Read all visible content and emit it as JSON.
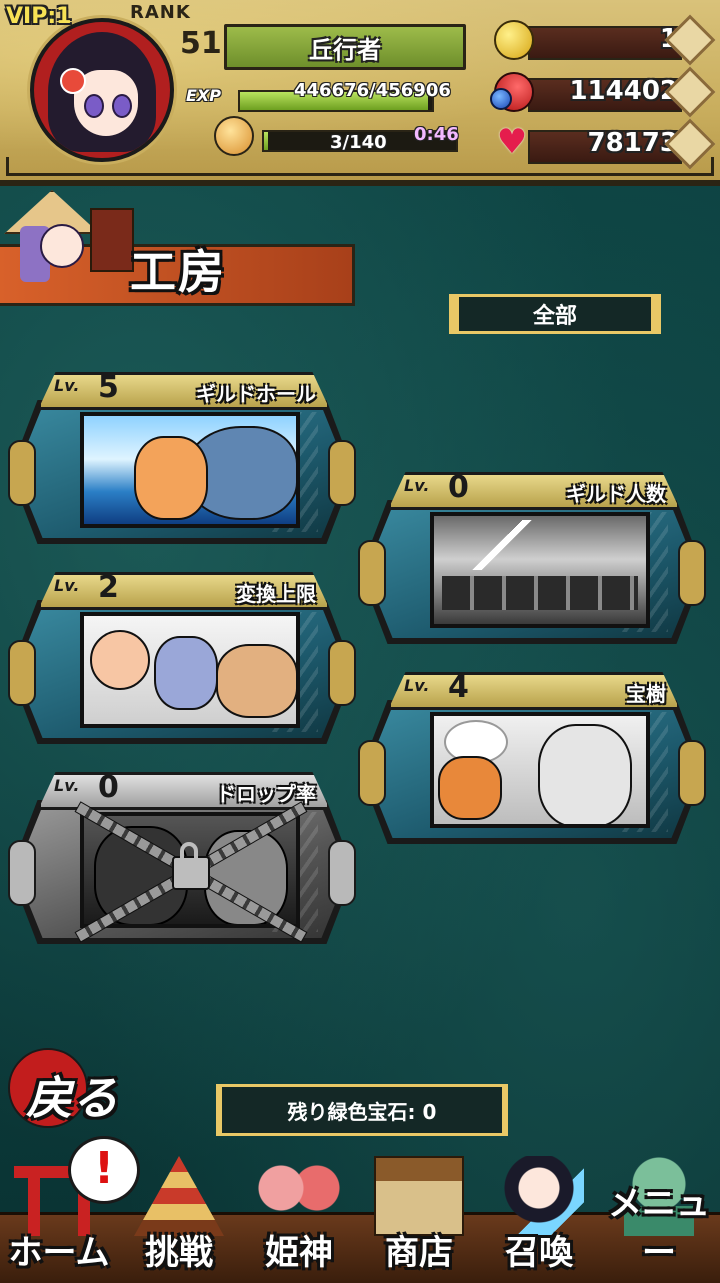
{
  "status": {
    "vip": "VIP:1",
    "rank_label": "RANK",
    "rank_value": "51",
    "title": "丘行者",
    "exp_label": "EXP",
    "exp_text": "446676/456906",
    "exp_progress": 0.977,
    "stamina_text": "3/140",
    "stamina_progress": 0.021,
    "timer": "0:46"
  },
  "resources": [
    {
      "icon": "gold-coin-icon",
      "value": "1"
    },
    {
      "icon": "orb-icon",
      "value": "114402"
    },
    {
      "icon": "winged-heart-icon",
      "value": "78173"
    }
  ],
  "header": {
    "title": "工房"
  },
  "filter": {
    "label": "全部"
  },
  "workshops": [
    {
      "lv_label": "Lv.",
      "level": "5",
      "name": "ギルドホール",
      "locked": false
    },
    {
      "lv_label": "Lv.",
      "level": "0",
      "name": "ギルド人数",
      "locked": false
    },
    {
      "lv_label": "Lv.",
      "level": "2",
      "name": "変換上限",
      "locked": false
    },
    {
      "lv_label": "Lv.",
      "level": "4",
      "name": "宝樹",
      "locked": false
    },
    {
      "lv_label": "Lv.",
      "level": "0",
      "name": "ドロップ率",
      "locked": true
    }
  ],
  "back_button": {
    "label": "戻る"
  },
  "gem_counter": {
    "text": "残り緑色宝石: 0"
  },
  "nav": [
    {
      "label": "ホーム",
      "icon": "torii-gate-icon",
      "alert": "!"
    },
    {
      "label": "挑戦",
      "icon": "pagoda-icon"
    },
    {
      "label": "姫神",
      "icon": "goddess-girls-icon"
    },
    {
      "label": "商店",
      "icon": "shop-stall-icon"
    },
    {
      "label": "召喚",
      "icon": "summon-girl-icon"
    },
    {
      "label": "メニュー",
      "icon": "jade-lion-icon"
    }
  ],
  "colors": {
    "background": "#0f4a4a",
    "gold_frame": "#e9c866",
    "top_bar": "#c9ae5e",
    "header_band": "#d8612a",
    "timer": "#f2b8ff"
  }
}
